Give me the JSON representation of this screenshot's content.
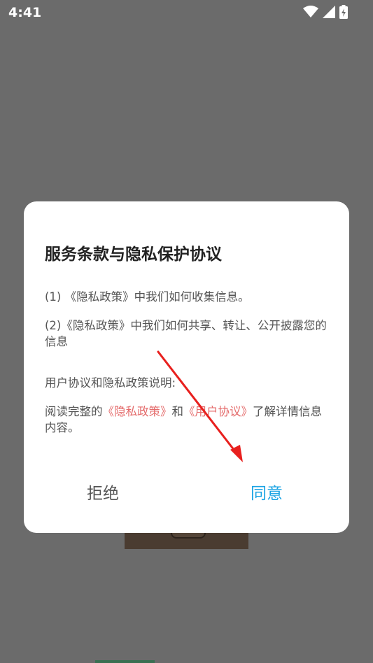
{
  "status_bar": {
    "time": "4:41",
    "icons": [
      "wifi-icon",
      "signal-icon",
      "battery-charging-icon"
    ]
  },
  "dialog": {
    "title": "服务条款与隐私保护协议",
    "paragraphs": {
      "p1": "(1) 《隐私政策》中我们如何收集信息。",
      "p2": "(2)《隐私政策》中我们如何共享、转让、公开披露您的信息",
      "p3": "用户协议和隐私政策说明:",
      "p4_prefix": "阅读完整的",
      "p4_link_privacy": "《隐私政策》",
      "p4_mid": "和",
      "p4_link_user": "《用户协议》",
      "p4_suffix": "了解详情信息内容。"
    },
    "buttons": {
      "reject": "拒绝",
      "agree": "同意"
    }
  },
  "colors": {
    "overlay": "#6b6b6b",
    "link": "#e46a6a",
    "agree": "#1aa3e3",
    "arrow": "#e8201e"
  }
}
